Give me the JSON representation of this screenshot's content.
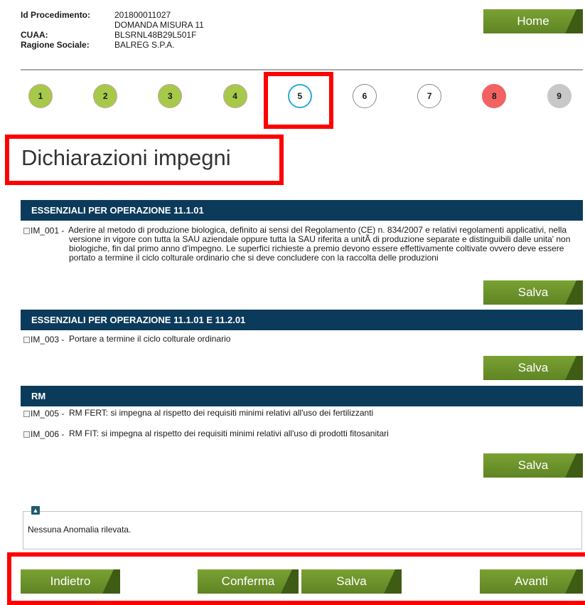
{
  "header": {
    "id_label": "Id Procedimento:",
    "id_value": "201800011027",
    "domanda": "DOMANDA MISURA 11",
    "cuaa_label": "CUAA:",
    "cuaa_value": "BLSRNL48B29L501F",
    "ragione_label": "Ragione Sociale:",
    "ragione_value": "BALREG S.P.A.",
    "home_label": "Home"
  },
  "steps": [
    {
      "label": "1",
      "state": "done"
    },
    {
      "label": "2",
      "state": "done"
    },
    {
      "label": "3",
      "state": "done"
    },
    {
      "label": "4",
      "state": "done"
    },
    {
      "label": "5",
      "state": "current"
    },
    {
      "label": "6",
      "state": "todo"
    },
    {
      "label": "7",
      "state": "todo"
    },
    {
      "label": "8",
      "state": "error"
    },
    {
      "label": "9",
      "state": "disabled"
    }
  ],
  "page_title": "Dichiarazioni impegni",
  "sections": [
    {
      "title": "ESSENZIALI PER OPERAZIONE 11.1.01",
      "items": [
        {
          "code": "IM_001 -",
          "text": "Aderire al metodo di produzione biologica, definito ai sensi del Regolamento (CE) n. 834/2007 e relativi regolamenti applicativi, nella versione in vigore con tutta la SAU aziendale oppure tutta la SAU riferita a unitÃ  di produzione separate e distinguibili dalle unita' non biologiche, fin dal primo anno d'impegno. Le superfici richieste a premio devono essere effettivamente coltivate ovvero deve essere portato a termine il ciclo colturale ordinario che si deve concludere con la raccolta delle produzioni"
        }
      ],
      "save_label": "Salva"
    },
    {
      "title": "ESSENZIALI PER OPERAZIONE 11.1.01 E 11.2.01",
      "items": [
        {
          "code": "IM_003 -",
          "text": "Portare a termine il ciclo colturale ordinario"
        }
      ],
      "save_label": "Salva"
    },
    {
      "title": "RM",
      "items": [
        {
          "code": "IM_005 -",
          "text": "RM FERT: si impegna al rispetto dei requisiti minimi relativi all'uso dei fertilizzanti"
        },
        {
          "code": "IM_006 -",
          "text": "RM FIT: si impegna al rispetto dei requisiti minimi relativi all'uso di prodotti fitosanitari"
        }
      ],
      "save_label": "Salva"
    }
  ],
  "anomalies": {
    "toggle_icon": "chevron-up-icon",
    "text": "Nessuna Anomalia rilevata."
  },
  "footer": {
    "back_label": "Indietro",
    "confirm_label": "Conferma",
    "save_label": "Salva",
    "next_label": "Avanti"
  },
  "colors": {
    "button_green": "#6b9129",
    "section_bar": "#0c3a5b",
    "step_done": "#a6c94a",
    "step_current_border": "#2ea8d8",
    "step_error": "#f26262",
    "step_disabled": "#c8c8c8",
    "highlight": "#ff0000"
  }
}
